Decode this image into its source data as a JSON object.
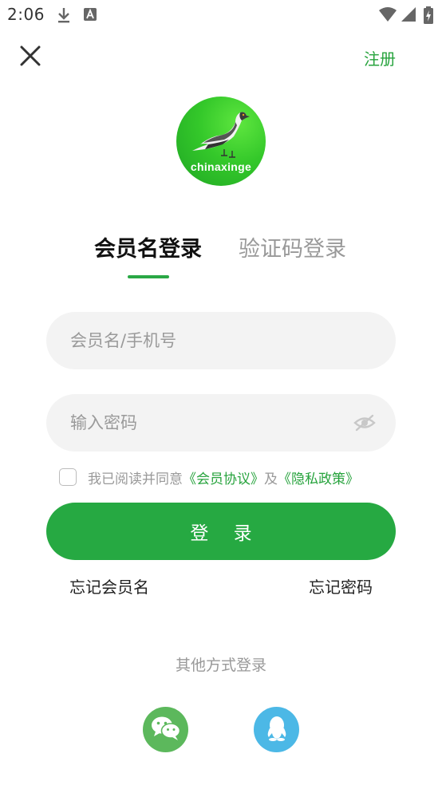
{
  "status_bar": {
    "time": "2:06",
    "icons": [
      "download-icon",
      "font-icon",
      "wifi-icon",
      "signal-icon",
      "battery-charging-icon"
    ]
  },
  "header": {
    "close_icon": "close-icon",
    "register_label": "注册"
  },
  "logo": {
    "text": "chinaxinge",
    "icon": "pigeon-icon"
  },
  "tabs": [
    {
      "label": "会员名登录",
      "active": true
    },
    {
      "label": "验证码登录",
      "active": false
    }
  ],
  "form": {
    "username": {
      "value": "",
      "placeholder": "会员名/手机号"
    },
    "password": {
      "value": "",
      "placeholder": "输入密码",
      "toggle_icon": "eye-hidden-icon"
    },
    "agreement": {
      "checked": false,
      "prefix": "我已阅读并同意",
      "link1": "《会员协议》",
      "middle": "及",
      "link2": "《隐私政策》"
    },
    "login_label": "登 录"
  },
  "links": {
    "forgot_username": "忘记会员名",
    "forgot_password": "忘记密码"
  },
  "other_login": {
    "title": "其他方式登录",
    "providers": [
      "wechat-icon",
      "qq-icon"
    ]
  },
  "colors": {
    "accent": "#27a33d",
    "button": "#26a942",
    "field_bg": "#f3f3f3",
    "wechat": "#5cb85c",
    "qq": "#4cb8e6"
  }
}
